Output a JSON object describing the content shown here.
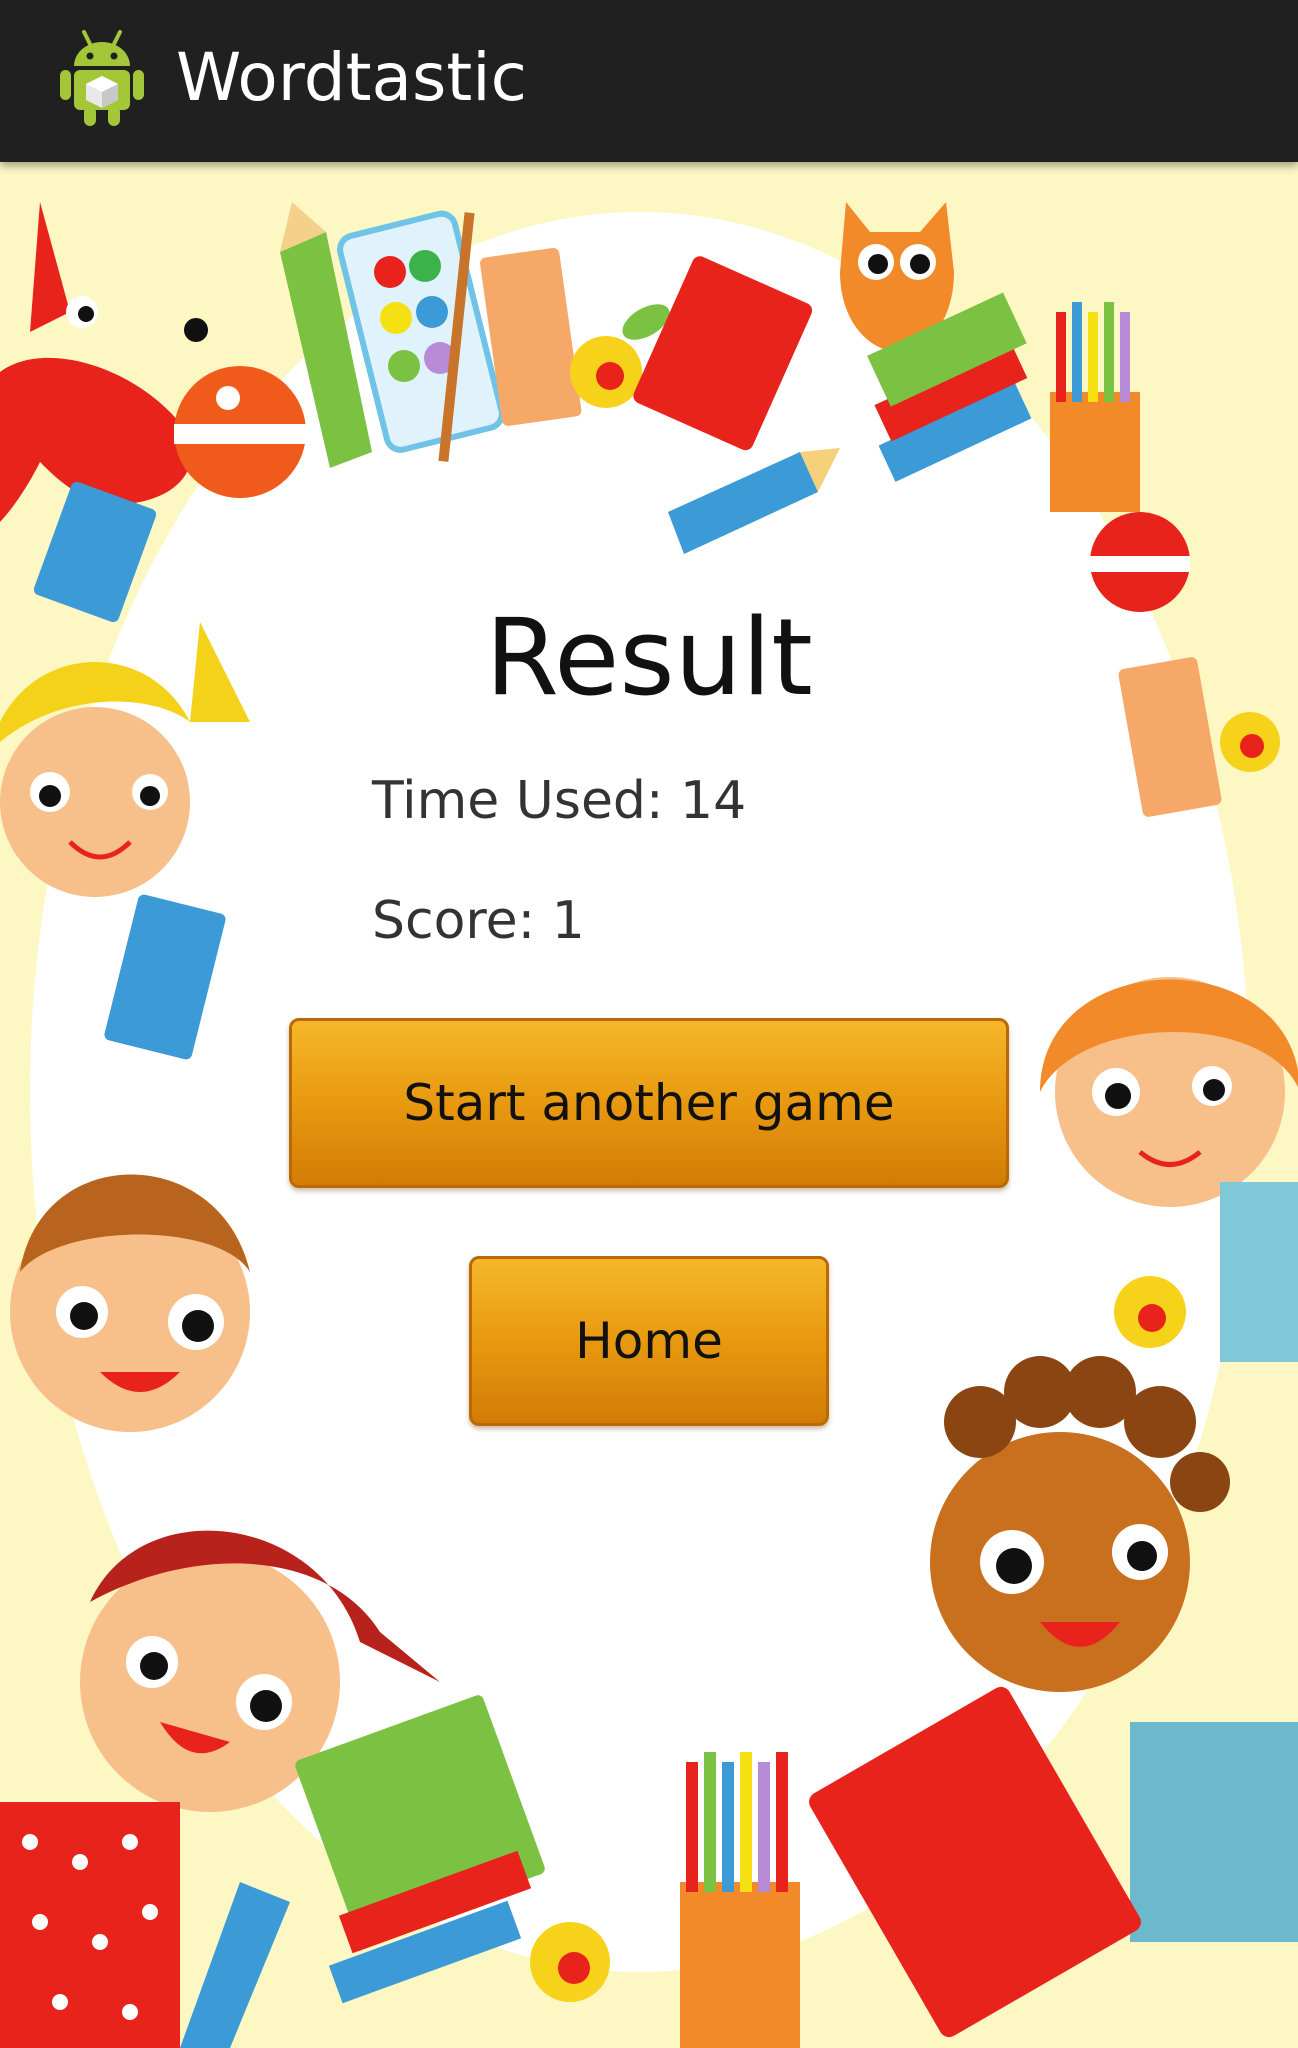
{
  "action_bar": {
    "title": "Wordtastic",
    "icon": "android-robot-icon"
  },
  "result": {
    "title": "Result",
    "time_used": "Time Used: 14",
    "score": "Score: 1"
  },
  "buttons": {
    "start_another_game": "Start another game",
    "home": "Home"
  },
  "colors": {
    "action_bar_bg": "#202020",
    "button_orange": "#e8990f",
    "background_cream": "#fdf7c4"
  }
}
